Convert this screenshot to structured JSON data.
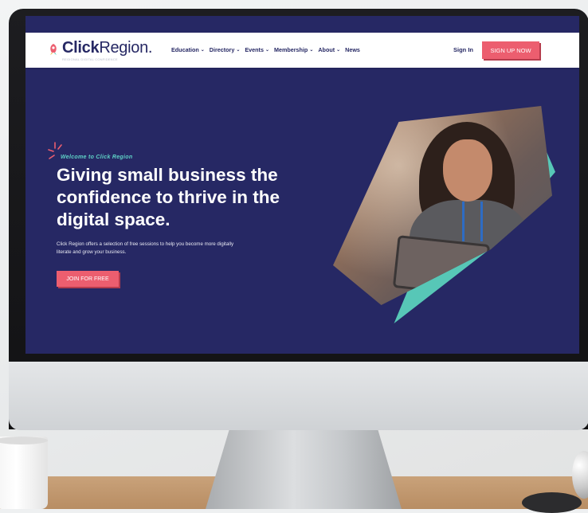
{
  "site": {
    "logo": {
      "bold": "Click",
      "rest": "Region.",
      "tagline": "REGIONAL DIGITAL CONFIDENCE"
    },
    "nav": [
      {
        "label": "Education",
        "dropdown": true
      },
      {
        "label": "Directory",
        "dropdown": true
      },
      {
        "label": "Events",
        "dropdown": true
      },
      {
        "label": "Membership",
        "dropdown": true
      },
      {
        "label": "About",
        "dropdown": true
      },
      {
        "label": "News",
        "dropdown": false
      }
    ],
    "sign_in": "Sign In",
    "sign_up": "SIGN UP NOW"
  },
  "hero": {
    "eyebrow": "Welcome to Click Region",
    "headline": "Giving small business the confidence to thrive in the digital space.",
    "description": "Click Region offers a selection of free sessions to help you become more digitally literate and grow your business.",
    "cta": "JOIN FOR FREE"
  },
  "colors": {
    "navy": "#262864",
    "coral": "#ec5e6f",
    "teal": "#57c7b7"
  },
  "icons": {
    "dropdown": "chevron-down-icon",
    "logo": "rocket-icon",
    "eyebrow": "sparkle-icon"
  }
}
